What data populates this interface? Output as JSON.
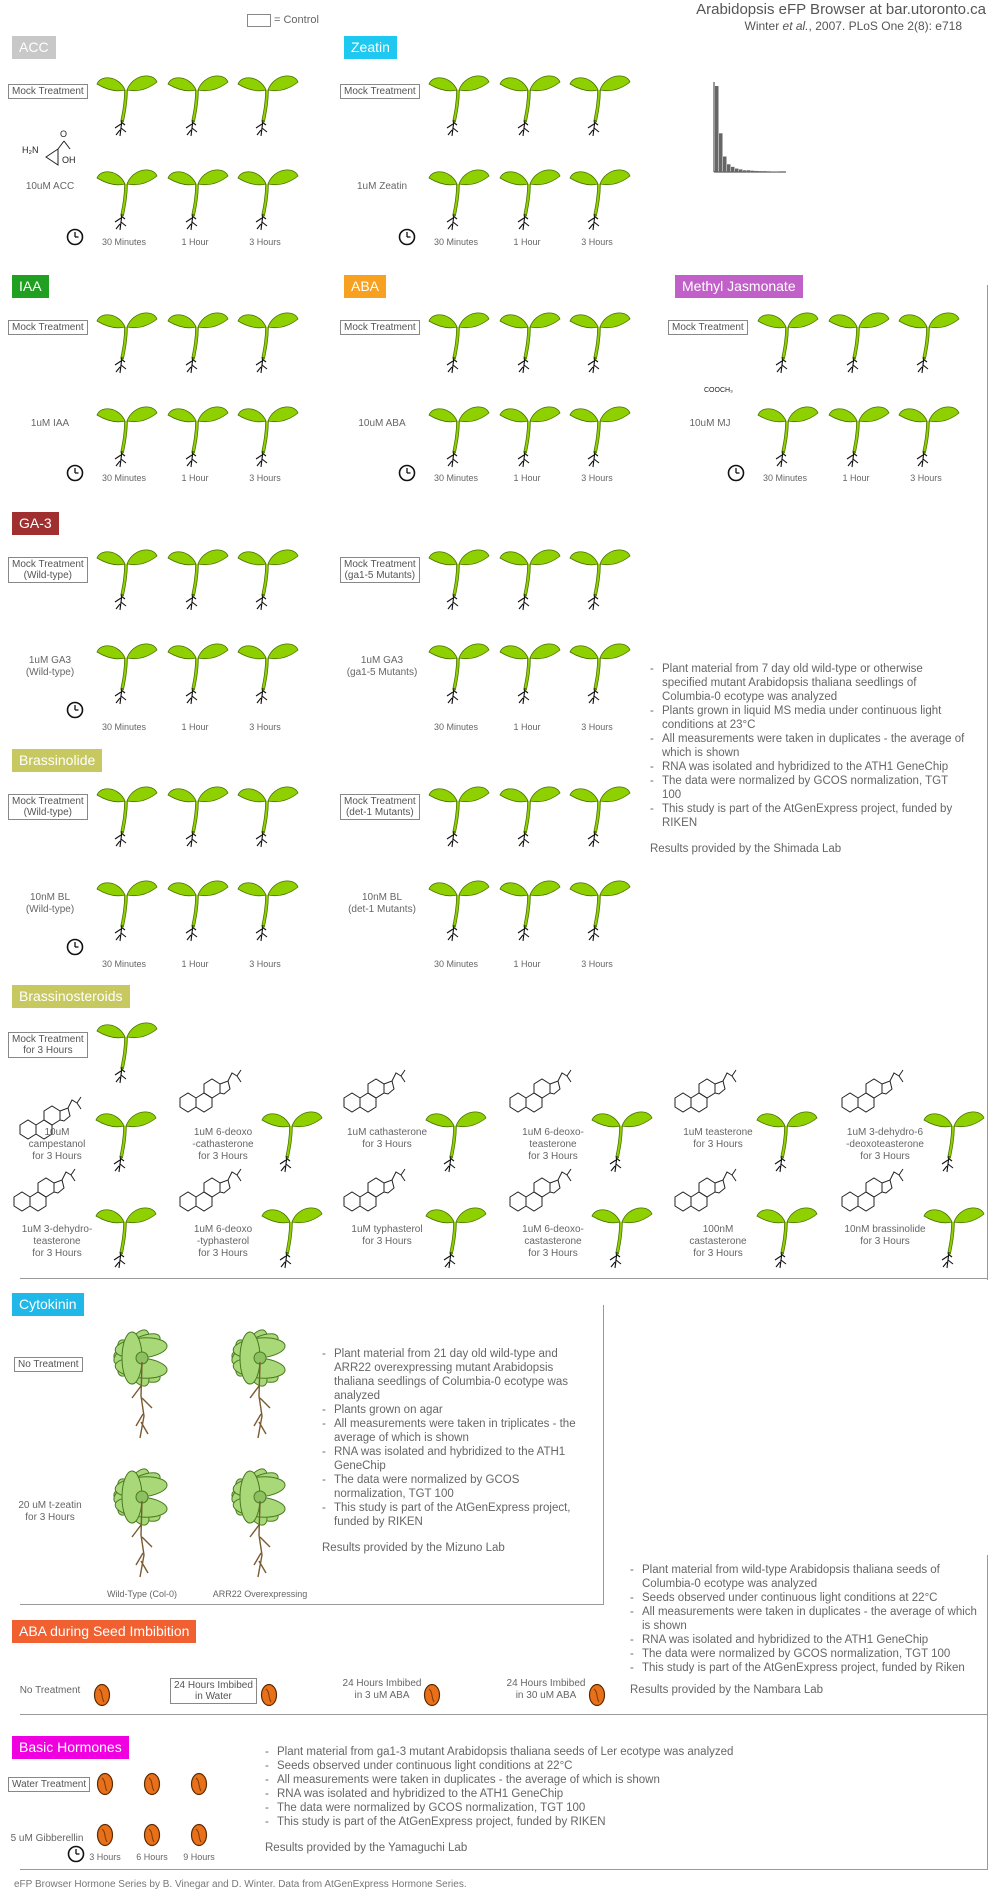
{
  "header": {
    "title": "Arabidopsis eFP Browser at bar.utoronto.ca",
    "citation_prefix": "Winter ",
    "citation_etal": "et al.",
    "citation_suffix": ", 2007. PLoS One 2(8): e718",
    "control_legend": "= Control"
  },
  "colors": {
    "acc": "#c8c8c8",
    "zeatin": "#1ec8f0",
    "iaa": "#20a020",
    "aba": "#f8a020",
    "mj": "#c060c8",
    "ga3": "#a03030",
    "brassino": "#c8c860",
    "cytokinin": "#20b8e8",
    "aba_seed": "#f06030",
    "basic": "#f000e0",
    "seedling": "#8ed000"
  },
  "time_labels": [
    "30 Minutes",
    "1 Hour",
    "3 Hours"
  ],
  "acc": {
    "title": "ACC",
    "mock": "Mock Treatment",
    "treat": "10uM ACC",
    "mol_nh2": "H₂N",
    "mol_oh": "OH",
    "mol_o": "O"
  },
  "zeatin": {
    "title": "Zeatin",
    "mock": "Mock Treatment",
    "treat": "1uM Zeatin"
  },
  "iaa": {
    "title": "IAA",
    "mock": "Mock Treatment",
    "treat": "1uM IAA"
  },
  "aba": {
    "title": "ABA",
    "mock": "Mock Treatment",
    "treat": "10uM ABA"
  },
  "mj": {
    "title": "Methyl Jasmonate",
    "mock": "Mock Treatment",
    "treat": "10uM MJ",
    "mol_label": "COOCH₃"
  },
  "ga3": {
    "title": "GA-3",
    "mock_wt": "Mock Treatment\n(Wild-type)",
    "treat_wt": "1uM GA3\n(Wild-type)",
    "mock_mut": "Mock Treatment\n(ga1-5 Mutants)",
    "treat_mut": "1uM GA3\n(ga1-5 Mutants)"
  },
  "brassinolide": {
    "title": "Brassinolide",
    "mock_wt": "Mock Treatment\n(Wild-type)",
    "treat_wt": "10nM BL\n(Wild-type)",
    "mock_mut": "Mock Treatment\n(det-1 Mutants)",
    "treat_mut": "10nM BL\n(det-1 Mutants)"
  },
  "hormone_notes": {
    "items": [
      "Plant material from 7 day old wild-type or otherwise specified mutant Arabidopsis thaliana seedlings of Columbia-0 ecotype was analyzed",
      "Plants grown in liquid MS media under continuous light conditions at 23°C",
      "All measurements were taken in duplicates - the average of which is shown",
      "RNA was isolated and hybridized to the ATH1 GeneChip",
      "The data were normalized by GCOS normalization, TGT 100",
      "This study is part of the AtGenExpress project, funded by RIKEN"
    ],
    "credit": "Results provided by the Shimada Lab"
  },
  "brassinosteroids": {
    "title": "Brassinosteroids",
    "mock": "Mock Treatment\nfor 3 Hours",
    "row1": [
      "10uM\ncampestanol\nfor 3 Hours",
      "1uM 6-deoxo\n-cathasterone\nfor 3 Hours",
      "1uM cathasterone\nfor 3 Hours",
      "1uM 6-deoxo-\nteasterone\nfor 3 Hours",
      "1uM teasterone\nfor 3 Hours",
      "1uM 3-dehydro-6\n-deoxoteasterone\nfor 3 Hours"
    ],
    "row2": [
      "1uM 3-dehydro-\nteasterone\nfor 3 Hours",
      "1uM 6-deoxo\n-typhasterol\nfor 3 Hours",
      "1uM typhasterol\nfor 3 Hours",
      "1uM 6-deoxo-\ncastasterone\nfor 3 Hours",
      "100nM\ncastasterone\nfor 3 Hours",
      "10nM brassinolide\nfor 3 Hours"
    ]
  },
  "cytokinin": {
    "title": "Cytokinin",
    "no_treatment": "No Treatment",
    "treat": "20 uM t-zeatin\nfor 3 Hours",
    "wt_label": "Wild-Type (Col-0)",
    "arr_label": "ARR22 Overexpressing",
    "notes": [
      "Plant material from 21 day old wild-type and ARR22 overexpressing mutant Arabidopsis thaliana seedlings of Columbia-0 ecotype was analyzed",
      "Plants grown on agar",
      "All measurements were taken in triplicates - the average of which is shown",
      "RNA was isolated and hybridized to the ATH1 GeneChip",
      "The data were normalized by GCOS normalization, TGT 100",
      "This study is part of the AtGenExpress project, funded by RIKEN"
    ],
    "credit": "Results provided by the Mizuno Lab"
  },
  "aba_seed": {
    "title": "ABA during Seed Imbibition",
    "no_treatment": "No Treatment",
    "water": "24 Hours Imbibed\nin Water",
    "aba3": "24 Hours Imbibed\nin 3 uM ABA",
    "aba30": "24 Hours Imbibed\nin 30 uM ABA",
    "notes": [
      "Plant material from wild-type Arabidopsis thaliana seeds of Columbia-0 ecotype was analyzed",
      "Seeds observed under continuous light conditions at 22°C",
      "All measurements were taken in duplicates - the average of which is shown",
      "RNA was isolated and hybridized to the ATH1 GeneChip",
      "The data were normalized by GCOS normalization, TGT 100",
      "This study is part of the AtGenExpress project, funded by Riken"
    ],
    "credit": "Results provided by the Nambara Lab"
  },
  "basic": {
    "title": "Basic Hormones",
    "water": "Water Treatment",
    "treat": "5 uM Gibberellin",
    "times": [
      "3 Hours",
      "6 Hours",
      "9 Hours"
    ],
    "notes": [
      "Plant material from ga1-3 mutant Arabidopsis thaliana seeds of Ler ecotype was analyzed",
      "Seeds observed under continuous light conditions at 22°C",
      "All measurements were taken in duplicates - the average of which is shown",
      "RNA was isolated and hybridized to the ATH1 GeneChip",
      "The data were normalized by GCOS normalization, TGT 100",
      "This study is part of the AtGenExpress project,  funded by RIKEN"
    ],
    "credit": "Results provided by the Yamaguchi Lab"
  },
  "footer": "eFP Browser Hormone Series by B. Vinegar and D. Winter.  Data from AtGenExpress Hormone Series.",
  "histogram": {
    "type": "bar",
    "values": [
      1.0,
      0.45,
      0.18,
      0.09,
      0.06,
      0.04,
      0.03,
      0.02,
      0.02,
      0.015,
      0.012,
      0.01,
      0.01,
      0.008,
      0.006,
      0.005
    ]
  }
}
